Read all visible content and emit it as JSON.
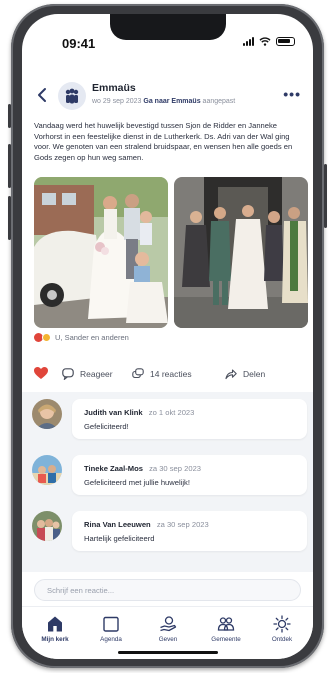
{
  "status_bar": {
    "time": "09:41"
  },
  "post": {
    "author": "Emmaüs",
    "date": "wo 29 sep 2023",
    "link_label": "Ga naar Emmaüs",
    "edited_label": "aangepast",
    "text": "Vandaag werd het huwelijk bevestigd tussen Sjon de Ridder en Janneke Vorhorst in een feestelijke dienst in de Lutherkerk. Ds. Adri van der Wal ging voor. We genoten van een stralend bruidspaar, en wensen hen alle goeds en Gods zegen op hun weg samen.",
    "likes_text": "U, Sander en anderen",
    "actions": {
      "reply_label": "Reageer",
      "reactions_label": "14 reacties",
      "share_label": "Delen"
    }
  },
  "comments": [
    {
      "author": "Judith van Klink",
      "date": "zo 1 okt 2023",
      "text": "Gefeliciteerd!"
    },
    {
      "author": "Tineke Zaal-Mos",
      "date": "za 30 sep 2023",
      "text": "Gefeliciteerd met jullie huwelijk!"
    },
    {
      "author": "Rina Van Leeuwen",
      "date": "za 30 sep 2023",
      "text": "Hartelijk gefeliciteerd"
    }
  ],
  "reply": {
    "placeholder": "Schrijf een reactie..."
  },
  "tabs": [
    {
      "label": "Mijn kerk",
      "icon": "church-icon",
      "active": true
    },
    {
      "label": "Agenda",
      "icon": "calendar-icon",
      "active": false
    },
    {
      "label": "Geven",
      "icon": "giving-icon",
      "active": false
    },
    {
      "label": "Gemeente",
      "icon": "community-icon",
      "active": false
    },
    {
      "label": "Ontdek",
      "icon": "discover-icon",
      "active": false
    }
  ],
  "colors": {
    "accent": "#2e3a66",
    "heart": "#e0453a",
    "comments_bg": "#f2f4f7"
  }
}
